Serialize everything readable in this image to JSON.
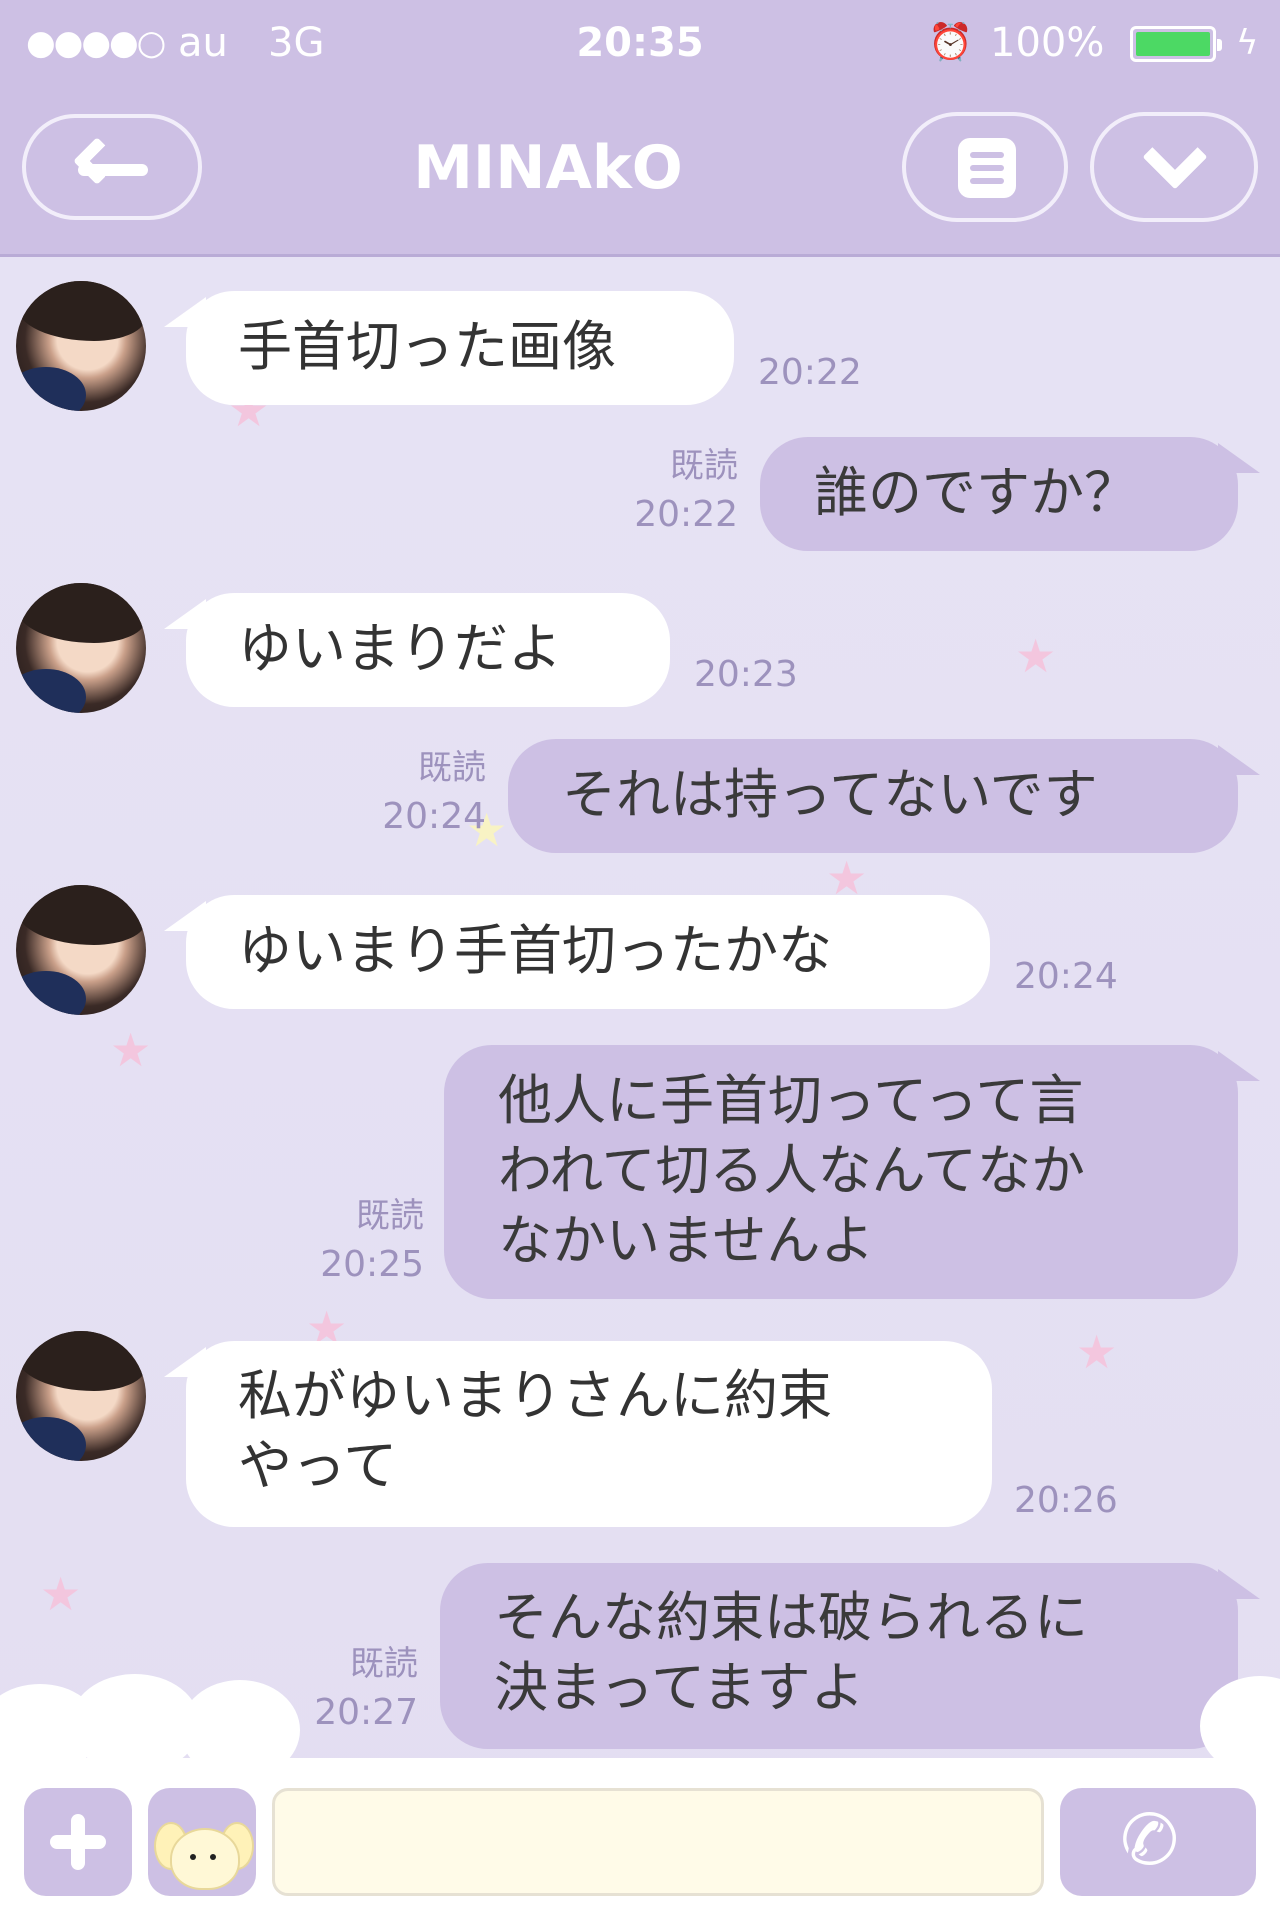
{
  "status_bar": {
    "signal": "●●●●○",
    "carrier": "au",
    "network": "3G",
    "time": "20:35",
    "alarm_icon": "alarm-clock-icon",
    "battery_percent": "100%",
    "battery_level": 1.0,
    "charging_icon": "lightning-bolt-icon"
  },
  "header": {
    "title": "MINAkO",
    "back_icon": "back-arrow-icon",
    "menu_icon": "menu-list-icon",
    "dropdown_icon": "chevron-down-icon"
  },
  "messages": [
    {
      "side": "in",
      "lines": [
        "手首切った画像"
      ],
      "time": "20:22"
    },
    {
      "side": "out",
      "lines": [
        "誰のですか？"
      ],
      "read": "既読",
      "time": "20:22"
    },
    {
      "side": "in",
      "lines": [
        "ゆいまりだよ"
      ],
      "time": "20:23"
    },
    {
      "side": "out",
      "lines": [
        "それは持ってないです"
      ],
      "read": "既読",
      "time": "20:24"
    },
    {
      "side": "in",
      "lines": [
        "ゆいまり手首切ったかな"
      ],
      "time": "20:24"
    },
    {
      "side": "out",
      "lines": [
        "他人に手首切ってって言",
        "われて切る人なんてなか",
        "なかいませんよ"
      ],
      "read": "既読",
      "time": "20:25"
    },
    {
      "side": "in",
      "lines": [
        "私がゆいまりさんに約束",
        "やって"
      ],
      "time": "20:26"
    },
    {
      "side": "out",
      "lines": [
        "そんな約束は破られるに",
        "決まってますよ"
      ],
      "read": "既読",
      "time": "20:27"
    }
  ],
  "input_bar": {
    "plus_icon": "plus-icon",
    "sticker_icon": "puppy-sticker-icon",
    "message_placeholder": "",
    "call_icon": "phone-icon"
  },
  "colors": {
    "theme_lavender": "#cdc0e4",
    "background": "#e6e1f3",
    "timestamp": "#9d92bd",
    "battery_green": "#4cd964"
  }
}
